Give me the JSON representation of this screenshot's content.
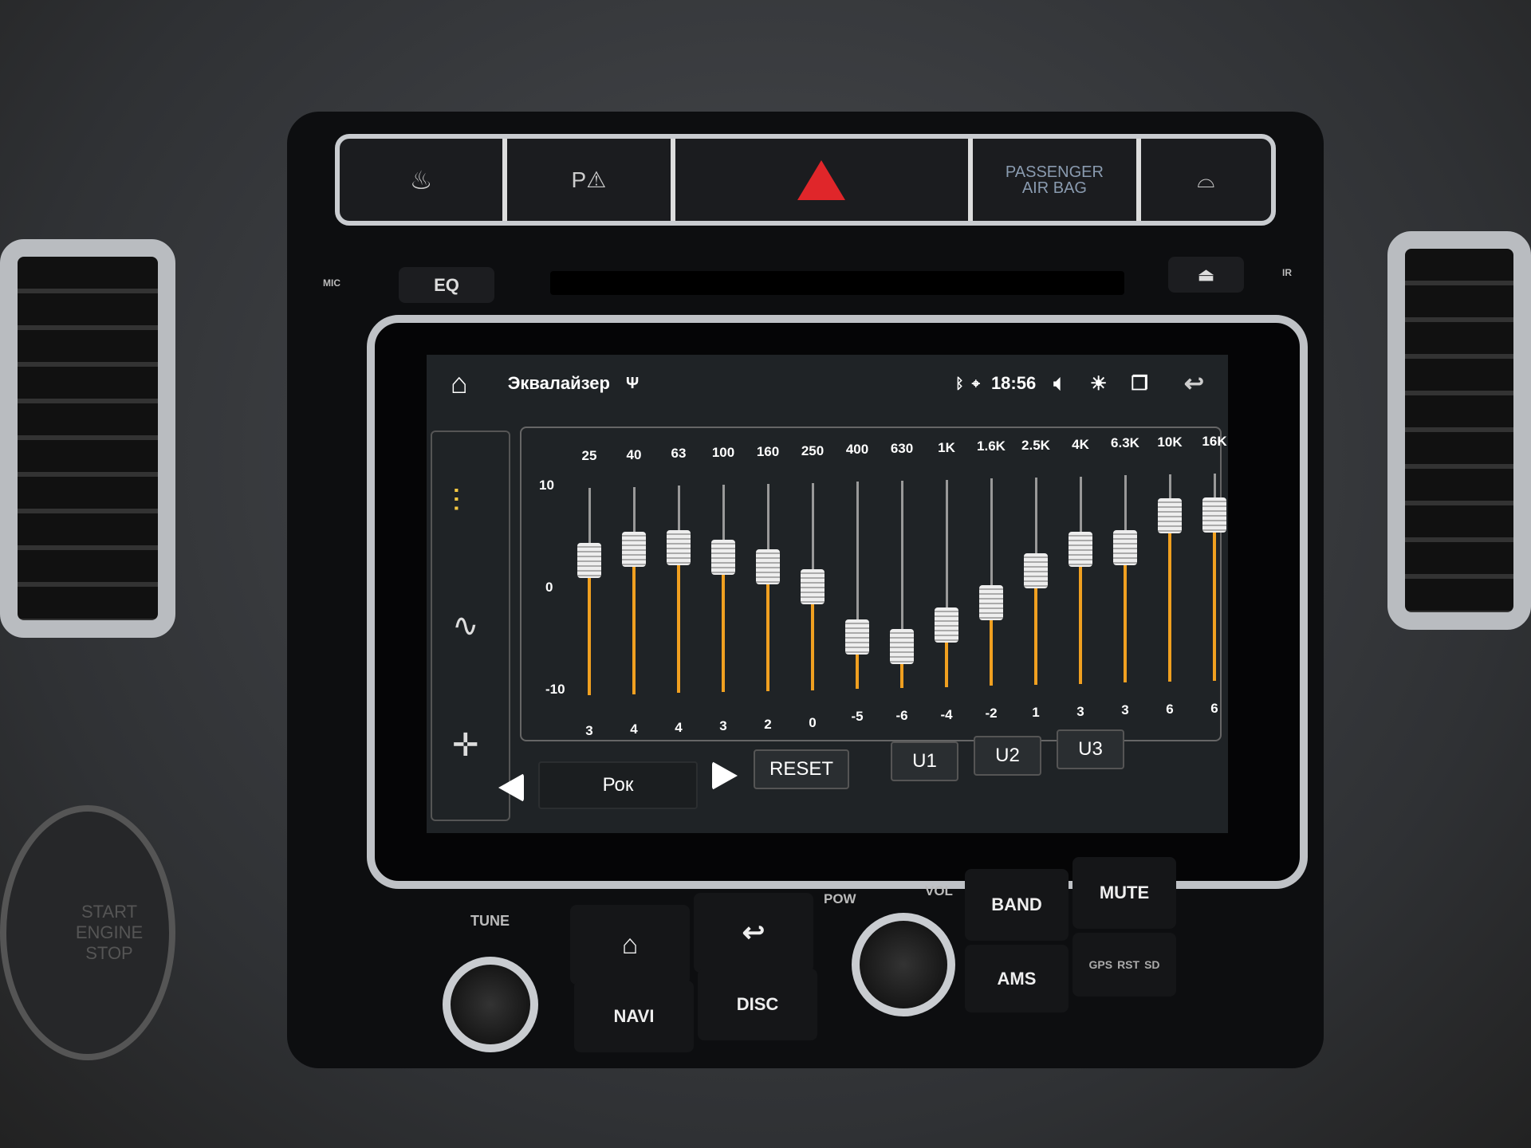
{
  "hardware": {
    "top_buttons": [
      "seat-heat-icon",
      "park-assist-icon",
      "hazard-icon",
      "PASSENGER AIR BAG",
      "defrost-icon"
    ],
    "airbag_label": "PASSENGER AIR BAG",
    "eq": "EQ",
    "mic": "MIC",
    "ir": "IR",
    "tune": "TUNE",
    "pow": "POW",
    "vol": "VOL",
    "band": "BAND",
    "mute": "MUTE",
    "ams": "AMS",
    "navi": "NAVI",
    "disc": "DISC",
    "gps": "GPS",
    "rst": "RST",
    "sd": "SD",
    "start_stop": "START ENGINE STOP"
  },
  "status": {
    "title": "Эквалайзер",
    "time": "18:56",
    "icons": [
      "home-icon",
      "usb-icon",
      "bluetooth-icon",
      "location-icon",
      "volume-icon",
      "brightness-icon",
      "windows-icon",
      "back-icon"
    ]
  },
  "sidebar": {
    "items": [
      "equalizer-sliders-icon",
      "waveform-icon",
      "balance-icon"
    ],
    "active": 0
  },
  "eq": {
    "frequencies": [
      "25",
      "40",
      "63",
      "100",
      "160",
      "250",
      "400",
      "630",
      "1K",
      "1.6K",
      "2.5K",
      "4K",
      "6.3K",
      "10K",
      "16K"
    ],
    "values": [
      3,
      4,
      4,
      3,
      2,
      0,
      -5,
      -6,
      -4,
      -2,
      1,
      3,
      3,
      6,
      6
    ],
    "value_labels": [
      "3",
      "4",
      "4",
      "3",
      "2",
      "0",
      "-5",
      "-6",
      "-4",
      "-2",
      "1",
      "3",
      "3",
      "6",
      "6"
    ],
    "range": [
      -10,
      10
    ],
    "y_labels": [
      "10",
      "0",
      "-10"
    ],
    "accent": "#f0a020"
  },
  "controls": {
    "preset": "Рок",
    "reset": "RESET",
    "u1": "U1",
    "u2": "U2",
    "u3": "U3"
  }
}
